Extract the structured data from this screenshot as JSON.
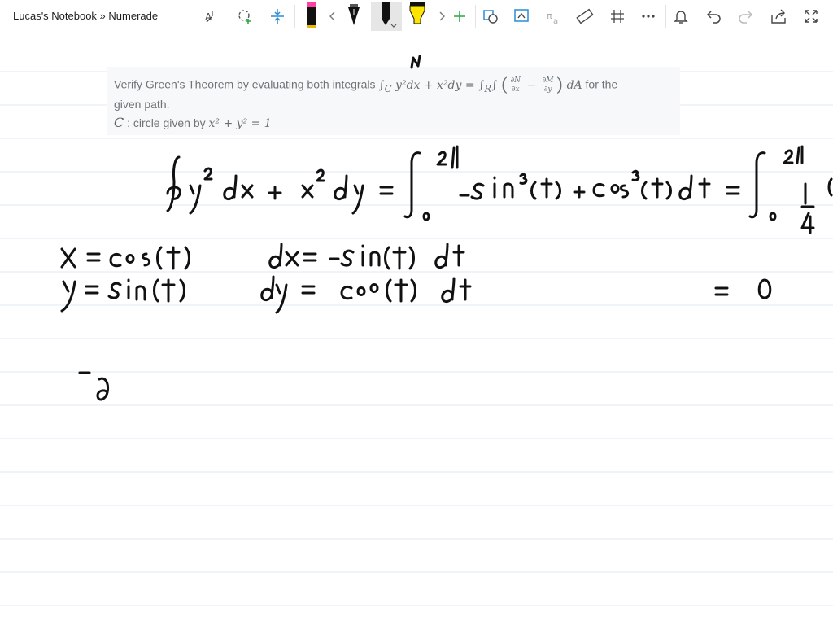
{
  "window": {
    "title": "Lucas's Notebook » Numerade"
  },
  "toolbar": {
    "tools": [
      {
        "name": "text-select-tool"
      },
      {
        "name": "lasso-tool"
      },
      {
        "name": "add-space-tool"
      },
      {
        "name": "pen-black"
      },
      {
        "name": "scroll-left"
      },
      {
        "name": "pen-black-2"
      },
      {
        "name": "pen-black-3"
      },
      {
        "name": "highlighter-yellow"
      },
      {
        "name": "scroll-right"
      },
      {
        "name": "add-pen"
      },
      {
        "name": "ink-to-shape"
      },
      {
        "name": "lasso-replay"
      },
      {
        "name": "math-tool"
      },
      {
        "name": "ruler-tool"
      },
      {
        "name": "grid-tool"
      },
      {
        "name": "more-options"
      },
      {
        "name": "notifications"
      },
      {
        "name": "undo"
      },
      {
        "name": "redo"
      },
      {
        "name": "share"
      },
      {
        "name": "full-screen"
      }
    ],
    "colors": {
      "pen_black": "#111111",
      "highlighter": "#ffe400",
      "pen_tip_pink": "#ff3fa4",
      "accent_blue": "#2a8bd6",
      "accent_green": "#27a844"
    }
  },
  "problem": {
    "line1_prefix": "Verify Green's Theorem by evaluating both integrals ",
    "line1_suffix": " for the",
    "line2": "given path.",
    "line3_prefix": " : circle given by ",
    "math": {
      "lhs": "∫",
      "lhs_sub": "C",
      "lhs_body": " y²dx + x²dy = ∫",
      "rhs_sub": "R",
      "rhs_int": "∫",
      "num1": "∂N",
      "den1": "∂x",
      "num2": "∂M",
      "den2": "∂y",
      "minus": " − ",
      "tail": " dA",
      "C": "C",
      "circle": "x² + y² = 1"
    }
  },
  "ink_color": "#111111"
}
